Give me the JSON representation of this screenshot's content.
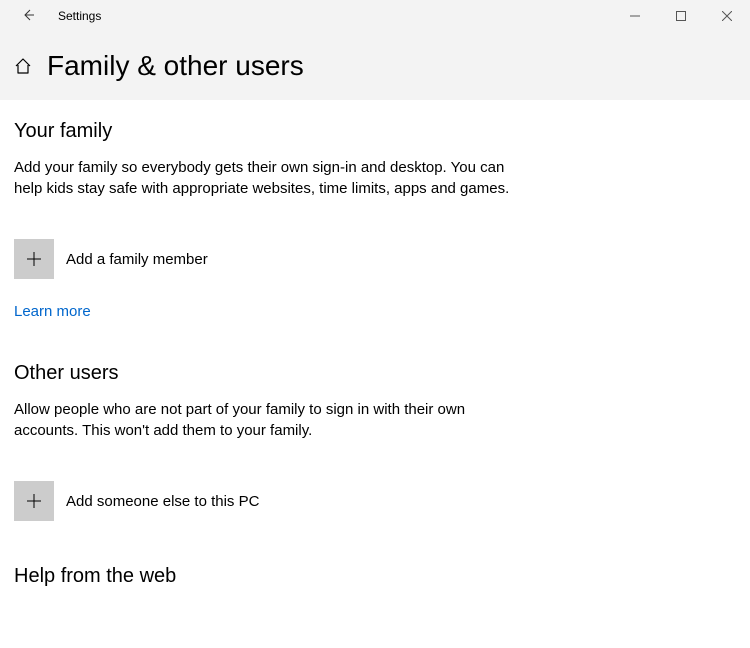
{
  "titleBar": {
    "title": "Settings"
  },
  "header": {
    "pageTitle": "Family & other users"
  },
  "family": {
    "heading": "Your family",
    "description": "Add your family so everybody gets their own sign-in and desktop. You can help kids stay safe with appropriate websites, time limits, apps and games.",
    "addLabel": "Add a family member",
    "learnMore": "Learn more"
  },
  "otherUsers": {
    "heading": "Other users",
    "description": "Allow people who are not part of your family to sign in with their own accounts. This won't add them to your family.",
    "addLabel": "Add someone else to this PC"
  },
  "help": {
    "heading": "Help from the web"
  }
}
